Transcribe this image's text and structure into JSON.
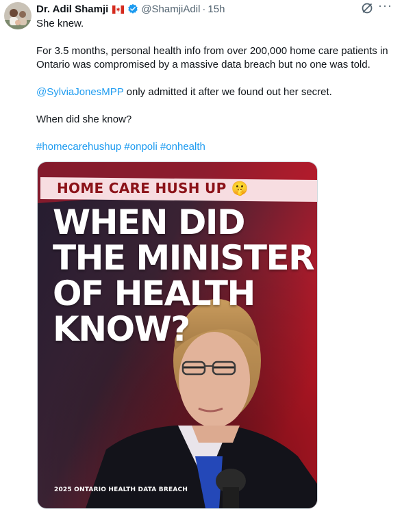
{
  "tweet": {
    "author_name": "Dr. Adil Shamji",
    "author_handle": "@ShamjiAdil",
    "separator": "·",
    "time": "15h",
    "more_label": "···",
    "paragraphs": {
      "p1": "She knew.",
      "p2": "For 3.5 months, personal health info from over 200,000 home care patients in Ontario was compromised by a massive data breach but no one was told.",
      "mention": "@SylviaJonesMPP",
      "p3_rest": " only admitted it after we found out her secret.",
      "p4": "When did she know?",
      "hashtags": "#homecarehushup #onpoli #onhealth"
    },
    "colors": {
      "link": "#1d9bf0",
      "secondary": "#536471",
      "verified": "#1d9bf0"
    },
    "icons": [
      "canada-flag-icon",
      "verified-badge-icon",
      "grok-icon",
      "more-icon"
    ]
  },
  "media": {
    "banner": "HOME CARE HUSH UP 🤫",
    "headline": "WHEN DID\nTHE MINISTER\nOF HEALTH\nKNOW?",
    "caption": "2025 ONTARIO HEALTH DATA BREACH",
    "colors": {
      "red": "#d11a2a",
      "dark": "#1f1a2c"
    }
  }
}
